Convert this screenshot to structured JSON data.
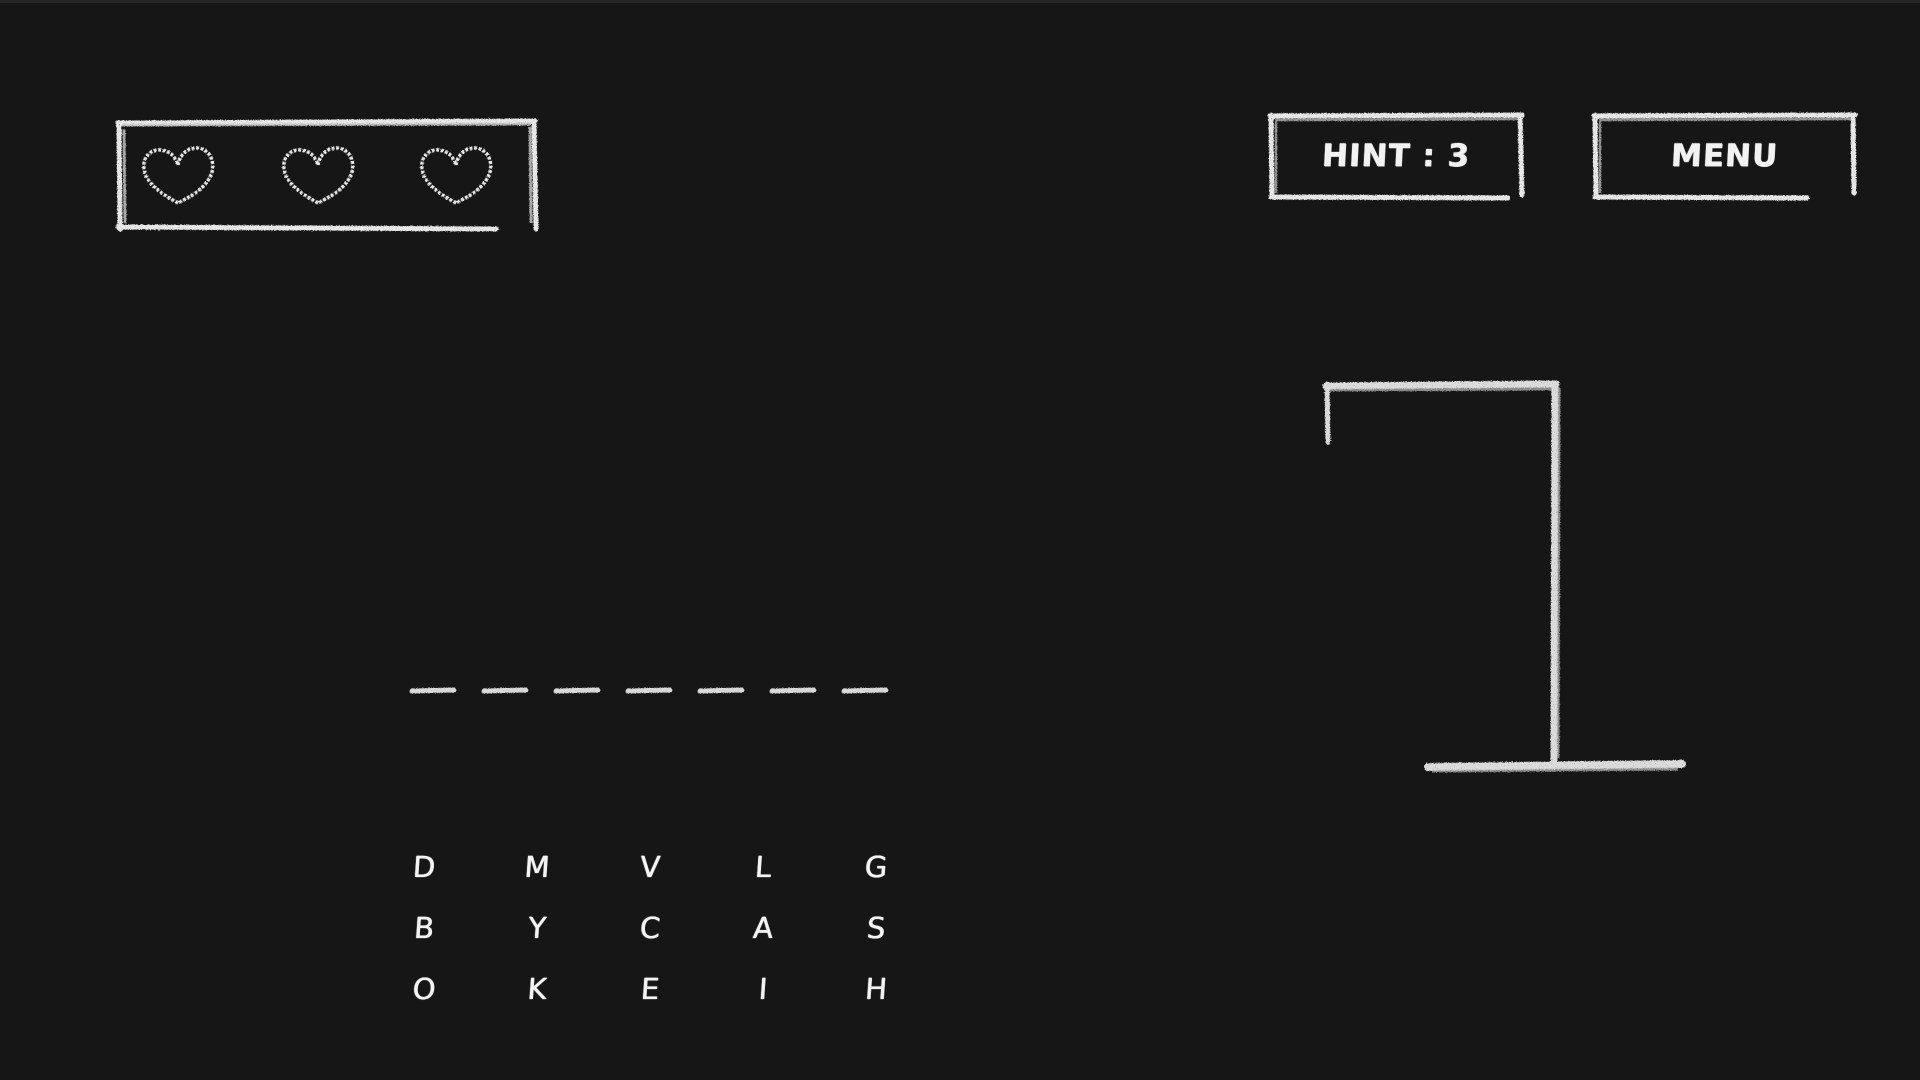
{
  "lives": {
    "count": 3,
    "icon": "heart-icon"
  },
  "buttons": {
    "hint_label": "HINT : 3",
    "menu_label": "MENU"
  },
  "word": {
    "slot_count": 7,
    "revealed": [
      "",
      "",
      "",
      "",
      "",
      "",
      ""
    ]
  },
  "keyboard": {
    "rows": [
      [
        "D",
        "M",
        "V",
        "L",
        "G"
      ],
      [
        "B",
        "Y",
        "C",
        "A",
        "S"
      ],
      [
        "O",
        "K",
        "E",
        "I",
        "H"
      ]
    ]
  },
  "gallows": {
    "parts_drawn": [
      "base",
      "pole",
      "beam",
      "rope"
    ]
  },
  "colors": {
    "background": "#161616",
    "chalk": "#f0f0f0"
  }
}
